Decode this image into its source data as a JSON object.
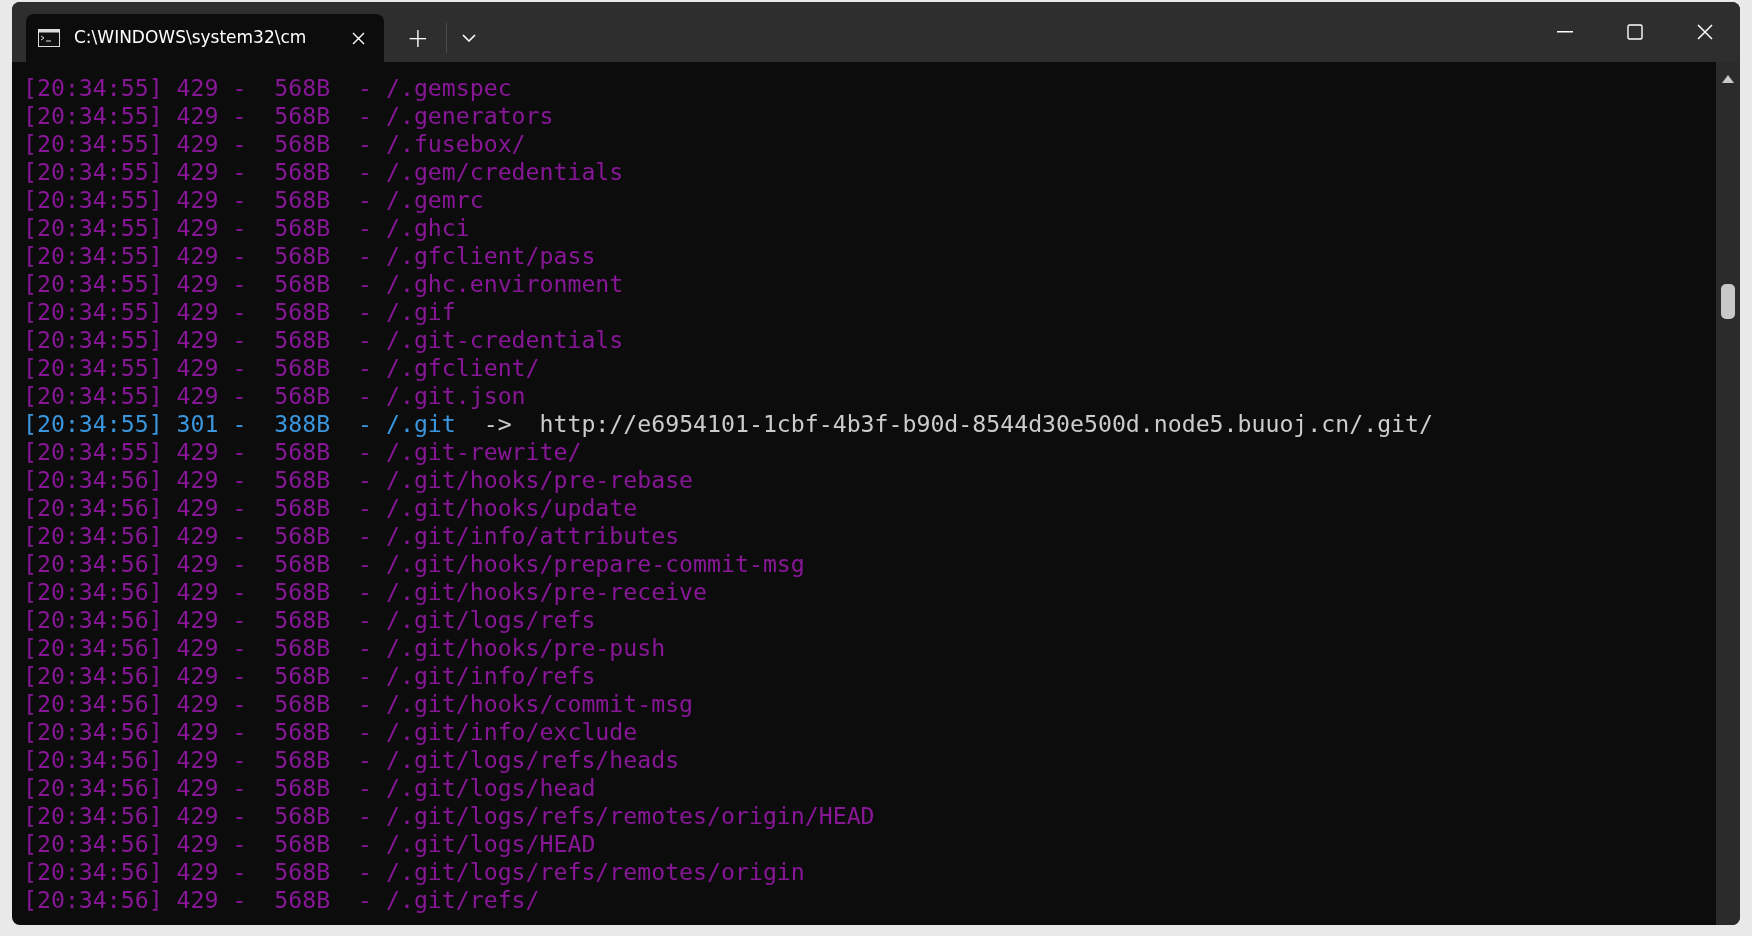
{
  "window": {
    "tabs": [
      {
        "title": "C:\\WINDOWS\\system32\\cm",
        "selected": true
      }
    ],
    "new_tab": "+"
  },
  "lines": [
    {
      "text": "[20:34:55] 429 -  568B  - /.gemspec",
      "color": "#881798"
    },
    {
      "text": "[20:34:55] 429 -  568B  - /.generators",
      "color": "#881798"
    },
    {
      "text": "[20:34:55] 429 -  568B  - /.fusebox/",
      "color": "#881798"
    },
    {
      "text": "[20:34:55] 429 -  568B  - /.gem/credentials",
      "color": "#881798"
    },
    {
      "text": "[20:34:55] 429 -  568B  - /.gemrc",
      "color": "#881798"
    },
    {
      "text": "[20:34:55] 429 -  568B  - /.ghci",
      "color": "#881798"
    },
    {
      "text": "[20:34:55] 429 -  568B  - /.gfclient/pass",
      "color": "#881798"
    },
    {
      "text": "[20:34:55] 429 -  568B  - /.ghc.environment",
      "color": "#881798"
    },
    {
      "text": "[20:34:55] 429 -  568B  - /.gif",
      "color": "#881798"
    },
    {
      "text": "[20:34:55] 429 -  568B  - /.git-credentials",
      "color": "#881798"
    },
    {
      "text": "[20:34:55] 429 -  568B  - /.gfclient/",
      "color": "#881798"
    },
    {
      "text": "[20:34:55] 429 -  568B  - /.git.json",
      "color": "#881798"
    },
    {
      "text": "[20:34:55] 301 -  388B  - /.git",
      "color": "#3a96dd",
      "redirect": "->  http://e6954101-1cbf-4b3f-b90d-8544d30e500d.node5.buuoj.cn/.git/"
    },
    {
      "text": "[20:34:55] 429 -  568B  - /.git-rewrite/",
      "color": "#881798"
    },
    {
      "text": "[20:34:56] 429 -  568B  - /.git/hooks/pre-rebase",
      "color": "#881798"
    },
    {
      "text": "[20:34:56] 429 -  568B  - /.git/hooks/update",
      "color": "#881798"
    },
    {
      "text": "[20:34:56] 429 -  568B  - /.git/info/attributes",
      "color": "#881798"
    },
    {
      "text": "[20:34:56] 429 -  568B  - /.git/hooks/prepare-commit-msg",
      "color": "#881798"
    },
    {
      "text": "[20:34:56] 429 -  568B  - /.git/hooks/pre-receive",
      "color": "#881798"
    },
    {
      "text": "[20:34:56] 429 -  568B  - /.git/logs/refs",
      "color": "#881798"
    },
    {
      "text": "[20:34:56] 429 -  568B  - /.git/hooks/pre-push",
      "color": "#881798"
    },
    {
      "text": "[20:34:56] 429 -  568B  - /.git/info/refs",
      "color": "#881798"
    },
    {
      "text": "[20:34:56] 429 -  568B  - /.git/hooks/commit-msg",
      "color": "#881798"
    },
    {
      "text": "[20:34:56] 429 -  568B  - /.git/info/exclude",
      "color": "#881798"
    },
    {
      "text": "[20:34:56] 429 -  568B  - /.git/logs/refs/heads",
      "color": "#881798"
    },
    {
      "text": "[20:34:56] 429 -  568B  - /.git/logs/head",
      "color": "#881798"
    },
    {
      "text": "[20:34:56] 429 -  568B  - /.git/logs/refs/remotes/origin/HEAD",
      "color": "#881798"
    },
    {
      "text": "[20:34:56] 429 -  568B  - /.git/logs/HEAD",
      "color": "#881798"
    },
    {
      "text": "[20:34:56] 429 -  568B  - /.git/logs/refs/remotes/origin",
      "color": "#881798"
    },
    {
      "text": "[20:34:56] 429 -  568B  - /.git/refs/",
      "color": "#881798"
    }
  ]
}
